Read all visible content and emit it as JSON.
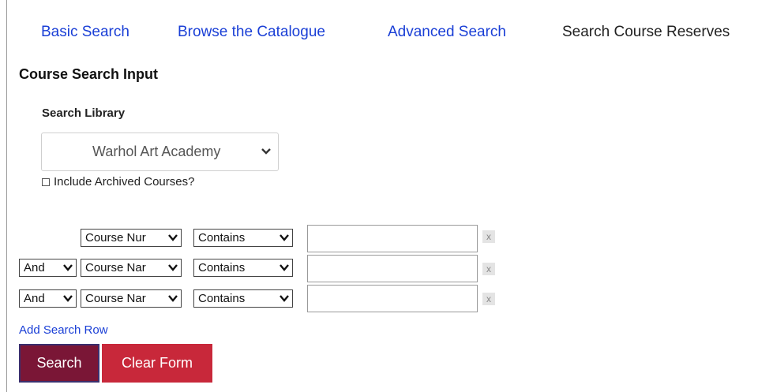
{
  "nav": {
    "tabs": [
      {
        "label": "Basic Search"
      },
      {
        "label": "Browse the Catalogue"
      },
      {
        "label": "Advanced Search"
      },
      {
        "label": "Search Course Reserves"
      }
    ]
  },
  "form": {
    "heading": "Course Search Input",
    "library_label": "Search Library",
    "library_value": "Warhol Art Academy",
    "archived_label": "Include Archived Courses?",
    "archived_checked": false,
    "rows": [
      {
        "operator": "",
        "field": "Course Nur",
        "match": "Contains",
        "value": ""
      },
      {
        "operator": "And",
        "field": "Course Nar",
        "match": "Contains",
        "value": ""
      },
      {
        "operator": "And",
        "field": "Course Nar",
        "match": "Contains",
        "value": ""
      }
    ],
    "remove_label": "x",
    "add_row_label": "Add Search Row",
    "search_button": "Search",
    "clear_button": "Clear Form"
  },
  "colors": {
    "link": "#1a3fd6",
    "search_button": "#7a1636",
    "clear_button": "#c8283a"
  }
}
